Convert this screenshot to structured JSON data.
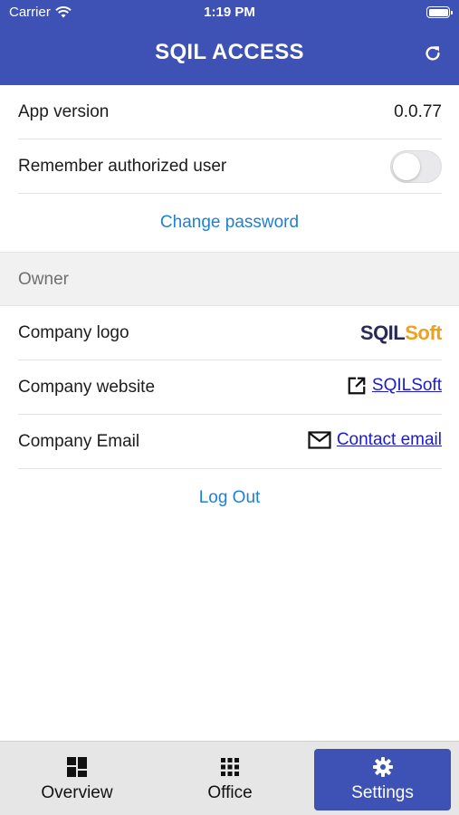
{
  "status_bar": {
    "carrier": "Carrier",
    "time": "1:19 PM"
  },
  "header": {
    "title": "SQIL ACCESS",
    "refresh_icon": "refresh-icon"
  },
  "settings": {
    "app_version_label": "App version",
    "app_version_value": "0.0.77",
    "remember_user_label": "Remember authorized user",
    "remember_user_enabled": false,
    "change_password_label": "Change password"
  },
  "owner": {
    "section_label": "Owner",
    "company_logo_label": "Company logo",
    "logo_text_part1": "SQIL",
    "logo_text_part2": "Soft",
    "company_website_label": "Company website",
    "company_website_link": "SQILSoft",
    "company_email_label": "Company Email",
    "company_email_link": "Contact email"
  },
  "logout_label": "Log Out",
  "tabs": [
    {
      "label": "Overview",
      "icon": "overview-icon",
      "active": false
    },
    {
      "label": "Office",
      "icon": "grid-icon",
      "active": false
    },
    {
      "label": "Settings",
      "icon": "gear-icon",
      "active": true
    }
  ],
  "colors": {
    "primary": "#3d52b4",
    "link": "#1e7fd8",
    "logo_dark": "#2a2a5a",
    "logo_orange": "#f0a020"
  }
}
